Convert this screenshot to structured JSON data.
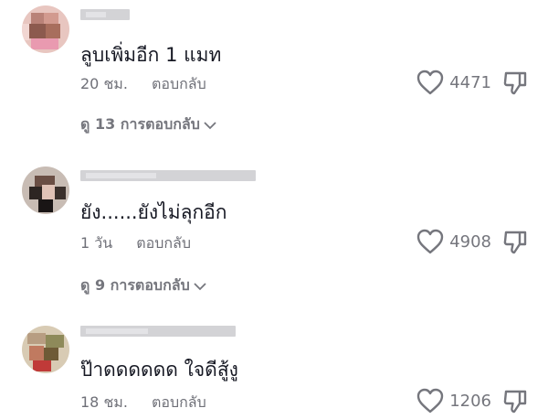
{
  "comments": [
    {
      "text": "ลูบเพิ่มอีก 1 แมท",
      "time": "20 ชม.",
      "reply_label": "ตอบกลับ",
      "likes": "4471",
      "view_replies": "ดู 13 การตอบกลับ"
    },
    {
      "text": "ยัง......ยังไม่ลุกอีก",
      "time": "1 วัน",
      "reply_label": "ตอบกลับ",
      "likes": "4908",
      "view_replies": "ดู 9 การตอบกลับ"
    },
    {
      "text": "ป๊าดดดดดด ใจดีสู้งู",
      "time": "18 ชม.",
      "reply_label": "ตอบกลับ",
      "likes": "1206"
    }
  ],
  "icons": {
    "like": "heart-outline-icon",
    "dislike": "thumbs-down-outline-icon",
    "expand": "chevron-down-icon"
  },
  "colors": {
    "text": "#161823",
    "secondary": "#75767d"
  }
}
